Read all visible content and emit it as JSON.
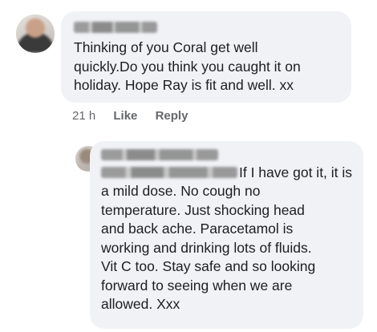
{
  "comments": [
    {
      "text": "Thinking of you Coral get well\nquickly.Do you think you caught it on\nholiday. Hope Ray is fit and well. xx",
      "time": "21 h",
      "actions": [
        "Like",
        "Reply"
      ]
    },
    {
      "text_first_line": "If I have got it, it is",
      "text": "a mild dose.  No cough no\ntemperature.  Just shocking head\nand back ache.  Paracetamol is\nworking and drinking lots of fluids.\nVit C too. Stay safe and so looking\nforward to seeing when we are\nallowed. Xxx"
    }
  ],
  "icons": {
    "avatar_1": "avatar",
    "avatar_2": "avatar"
  }
}
